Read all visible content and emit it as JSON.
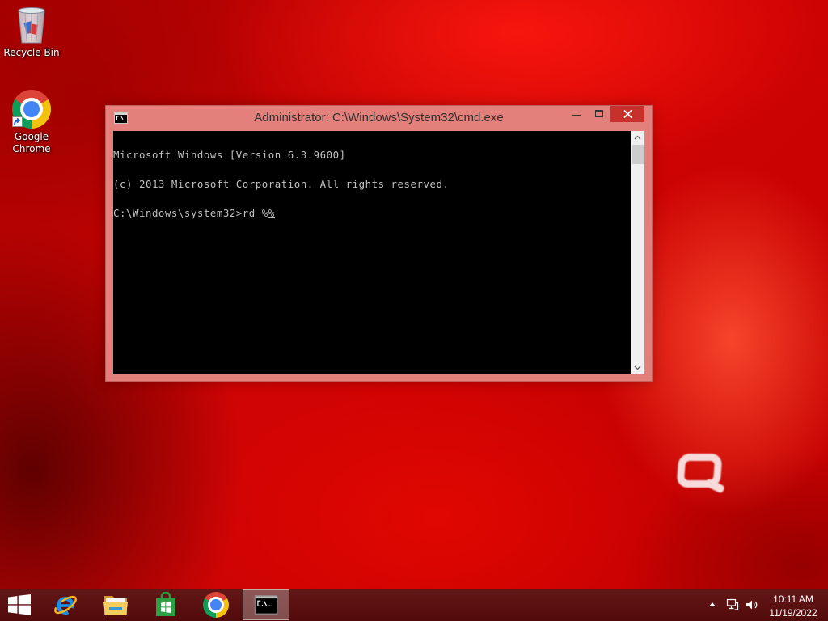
{
  "desktop": {
    "recycle_bin": {
      "label": "Recycle Bin",
      "icon": "recycle-bin-icon"
    },
    "chrome_shortcut": {
      "label_line1": "Google",
      "label_line2": "Chrome",
      "icon": "chrome-icon",
      "overlay_icon": "shortcut-arrow-icon"
    },
    "wallpaper": {
      "logo_icon": "compaq-logo"
    }
  },
  "cmd_window": {
    "title": "Administrator: C:\\Windows\\System32\\cmd.exe",
    "title_icon": "cmd-icon",
    "controls": [
      "minimize-icon",
      "maximize-icon",
      "close-icon"
    ],
    "console": {
      "lines": [
        "Microsoft Windows [Version 6.3.9600]",
        "(c) 2013 Microsoft Corporation. All rights reserved."
      ],
      "prompt": "C:\\Windows\\system32>",
      "input": "rd %%"
    },
    "scrollbar": {
      "position": 0
    }
  },
  "taskbar": {
    "start_icon": "windows-start-icon",
    "apps": [
      {
        "icon": "internet-explorer-icon",
        "active": false
      },
      {
        "icon": "file-explorer-icon",
        "active": false
      },
      {
        "icon": "store-icon",
        "active": false
      },
      {
        "icon": "chrome-icon",
        "active": false
      },
      {
        "icon": "cmd-icon",
        "active": true
      }
    ],
    "tray": {
      "icons": [
        "show-hidden-icons-icon",
        "network-icon",
        "volume-icon"
      ],
      "time": "10:11 AM",
      "date": "11/19/2022"
    }
  },
  "colors": {
    "window_frame": "#e3807c",
    "close_button": "#c7312b",
    "console_background": "#000000",
    "console_text": "#c0c0c0",
    "taskbar": "#5a0b0b",
    "title_text": "#2e2e2e"
  }
}
